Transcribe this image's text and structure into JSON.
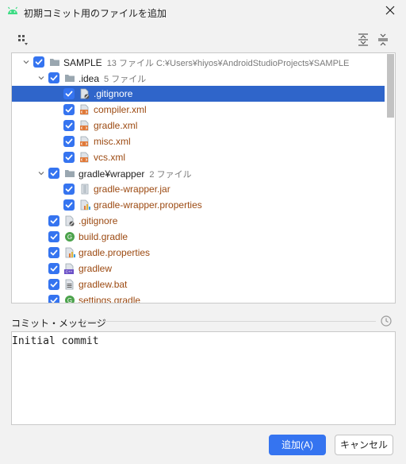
{
  "window": {
    "title": "初期コミット用のファイルを追加"
  },
  "toolbar": {
    "group_icon": "group-by-icon",
    "expand_icon": "expand-all-icon",
    "collapse_icon": "collapse-all-icon"
  },
  "tree": {
    "rows": [
      {
        "name": "SAMPLE",
        "meta": "13 ファイル  C:¥Users¥hiyos¥AndroidStudioProjects¥SAMPLE",
        "type": "folder",
        "expanded": true,
        "checked": true,
        "selected": false,
        "modified": false
      },
      {
        "name": ".idea",
        "meta": "5 ファイル",
        "type": "folder",
        "expanded": true,
        "checked": true,
        "selected": false,
        "modified": false
      },
      {
        "name": ".gitignore",
        "meta": "",
        "type": "ignore-file",
        "checked": true,
        "selected": true,
        "modified": false
      },
      {
        "name": "compiler.xml",
        "meta": "",
        "type": "xml-file",
        "checked": true,
        "selected": false,
        "modified": true
      },
      {
        "name": "gradle.xml",
        "meta": "",
        "type": "xml-file",
        "checked": true,
        "selected": false,
        "modified": true
      },
      {
        "name": "misc.xml",
        "meta": "",
        "type": "xml-file",
        "checked": true,
        "selected": false,
        "modified": true
      },
      {
        "name": "vcs.xml",
        "meta": "",
        "type": "xml-file",
        "checked": true,
        "selected": false,
        "modified": true
      },
      {
        "name": "gradle¥wrapper",
        "meta": "2 ファイル",
        "type": "folder",
        "expanded": true,
        "checked": true,
        "selected": false,
        "modified": false
      },
      {
        "name": "gradle-wrapper.jar",
        "meta": "",
        "type": "jar-file",
        "checked": true,
        "selected": false,
        "modified": true
      },
      {
        "name": "gradle-wrapper.properties",
        "meta": "",
        "type": "properties-file",
        "checked": true,
        "selected": false,
        "modified": true
      },
      {
        "name": ".gitignore",
        "meta": "",
        "type": "ignore-file",
        "checked": true,
        "selected": false,
        "modified": true
      },
      {
        "name": "build.gradle",
        "meta": "",
        "type": "gradle-file",
        "checked": true,
        "selected": false,
        "modified": true
      },
      {
        "name": "gradle.properties",
        "meta": "",
        "type": "properties-file",
        "checked": true,
        "selected": false,
        "modified": true
      },
      {
        "name": "gradlew",
        "meta": "",
        "type": "script-file",
        "checked": true,
        "selected": false,
        "modified": true
      },
      {
        "name": "gradlew.bat",
        "meta": "",
        "type": "bat-file",
        "checked": true,
        "selected": false,
        "modified": true
      },
      {
        "name": "settings.gradle",
        "meta": "",
        "type": "gradle-file",
        "checked": true,
        "selected": false,
        "modified": true
      }
    ]
  },
  "commit": {
    "label": "コミット・メッセージ",
    "message": "Initial commit",
    "history_icon": "history-icon"
  },
  "buttons": {
    "add": "追加(A)",
    "cancel": "キャンセル"
  },
  "colors": {
    "accent": "#3574f0",
    "selection": "#2f65ca",
    "modified_text": "#9c4a12"
  }
}
